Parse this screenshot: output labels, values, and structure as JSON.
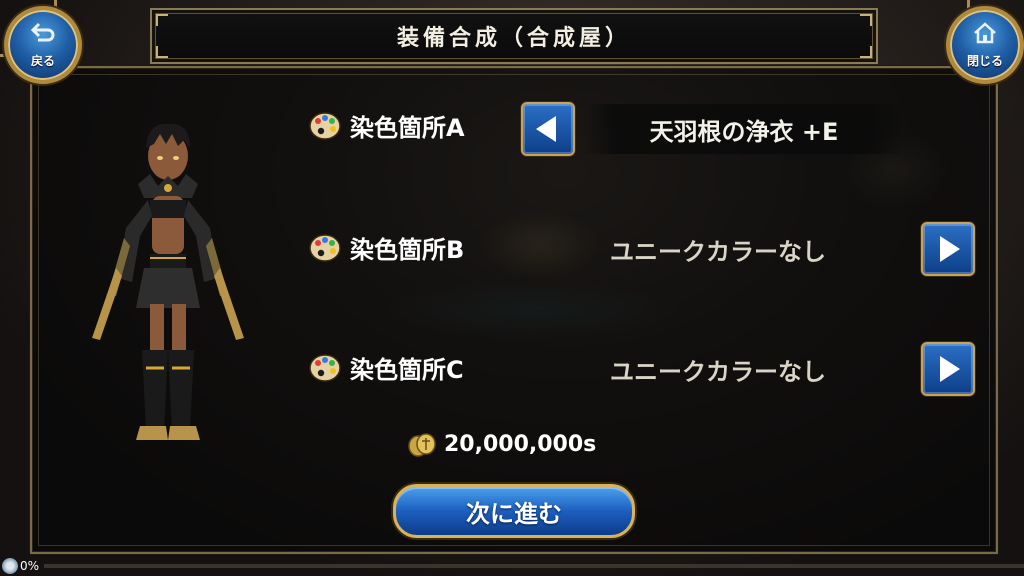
{
  "header": {
    "title": "装備合成（合成屋）",
    "back_label": "戻る",
    "close_label": "閉じる"
  },
  "dye_rows": [
    {
      "label": "染色箇所A",
      "value": "天羽根の浄衣 +E",
      "arrow": "left"
    },
    {
      "label": "染色箇所B",
      "value": "ユニークカラーなし",
      "arrow": "right"
    },
    {
      "label": "染色箇所C",
      "value": "ユニークカラーなし",
      "arrow": "right"
    }
  ],
  "cost": {
    "amount": "20,000,000s"
  },
  "actions": {
    "next_label": "次に進む"
  },
  "download": {
    "percent_text": "0%",
    "progress": 0
  },
  "colors": {
    "button_blue": "#1d5fbf",
    "gold_trim": "#c8a35c",
    "panel_bg": "#0a0a0a"
  },
  "icons": {
    "back": "return-arrow-icon",
    "close": "home-icon",
    "row": "palette-icon",
    "cost": "coin-icon"
  }
}
